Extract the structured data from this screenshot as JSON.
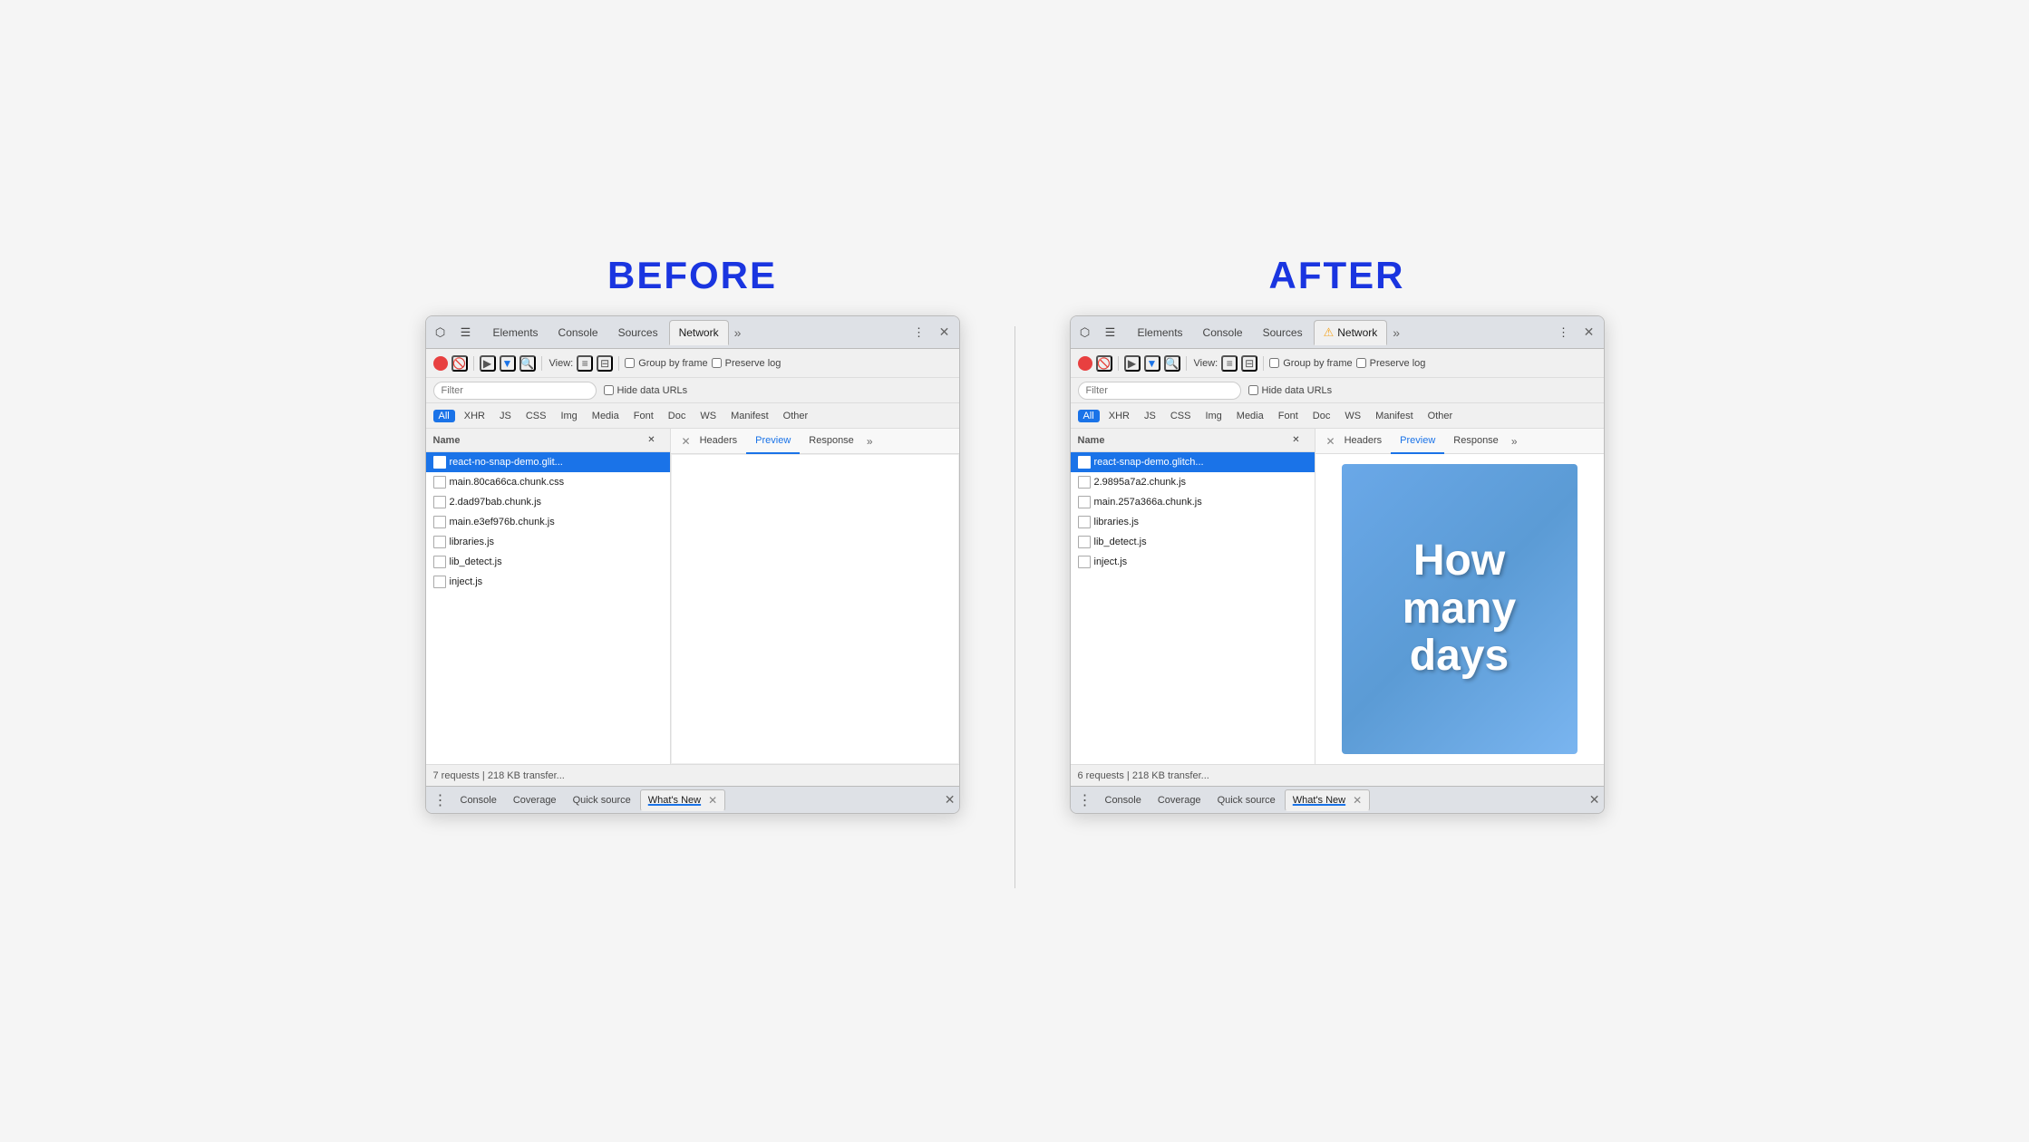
{
  "before": {
    "label": "BEFORE",
    "tabs": [
      "Elements",
      "Console",
      "Sources",
      "Network"
    ],
    "active_tab": "Network",
    "toolbar": {
      "view_label": "View:",
      "group_by_frame": "Group by frame",
      "preserve_log": "Preserve log"
    },
    "filter_placeholder": "Filter",
    "hide_data_urls": "Hide data URLs",
    "type_filters": [
      "All",
      "XHR",
      "JS",
      "CSS",
      "Img",
      "Media",
      "Font",
      "Doc",
      "WS",
      "Manifest",
      "Other"
    ],
    "active_filter": "All",
    "col_name": "Name",
    "detail_tabs": [
      "Headers",
      "Preview",
      "Response"
    ],
    "active_detail_tab": "Preview",
    "requests": [
      "react-no-snap-demo.glit...",
      "main.80ca66ca.chunk.css",
      "2.dad97bab.chunk.js",
      "main.e3ef976b.chunk.js",
      "libraries.js",
      "lib_detect.js",
      "inject.js"
    ],
    "selected_request": 0,
    "status": "7 requests | 218 KB transfer...",
    "drawer_tabs": [
      "Console",
      "Coverage",
      "Quick source",
      "What's New"
    ],
    "active_drawer_tab": "What's New"
  },
  "after": {
    "label": "AFTER",
    "tabs": [
      "Elements",
      "Console",
      "Sources",
      "Network"
    ],
    "active_tab": "Network",
    "toolbar": {
      "view_label": "View:",
      "group_by_frame": "Group by frame",
      "preserve_log": "Preserve log"
    },
    "filter_placeholder": "Filter",
    "hide_data_urls": "Hide data URLs",
    "type_filters": [
      "All",
      "XHR",
      "JS",
      "CSS",
      "Img",
      "Media",
      "Font",
      "Doc",
      "WS",
      "Manifest",
      "Other"
    ],
    "active_filter": "All",
    "col_name": "Name",
    "detail_tabs": [
      "Headers",
      "Preview",
      "Response"
    ],
    "active_detail_tab": "Preview",
    "requests": [
      "react-snap-demo.glitch...",
      "2.9895a7a2.chunk.js",
      "main.257a366a.chunk.js",
      "libraries.js",
      "lib_detect.js",
      "inject.js"
    ],
    "selected_request": 0,
    "preview_text": "How\nmany\ndays",
    "status": "6 requests | 218 KB transfer...",
    "drawer_tabs": [
      "Console",
      "Coverage",
      "Quick source",
      "What's New"
    ],
    "active_drawer_tab": "What's New"
  },
  "icons": {
    "cursor": "⬡",
    "mobile": "📱",
    "record": "●",
    "clear": "🚫",
    "video": "▶",
    "filter": "▼",
    "search": "🔍",
    "grid1": "≡",
    "grid2": "⊟",
    "more_tabs": "»",
    "menu": "⋮",
    "close": "✕",
    "drawer_menu": "⋮",
    "tab_close": "✕",
    "warning": "⚠"
  }
}
